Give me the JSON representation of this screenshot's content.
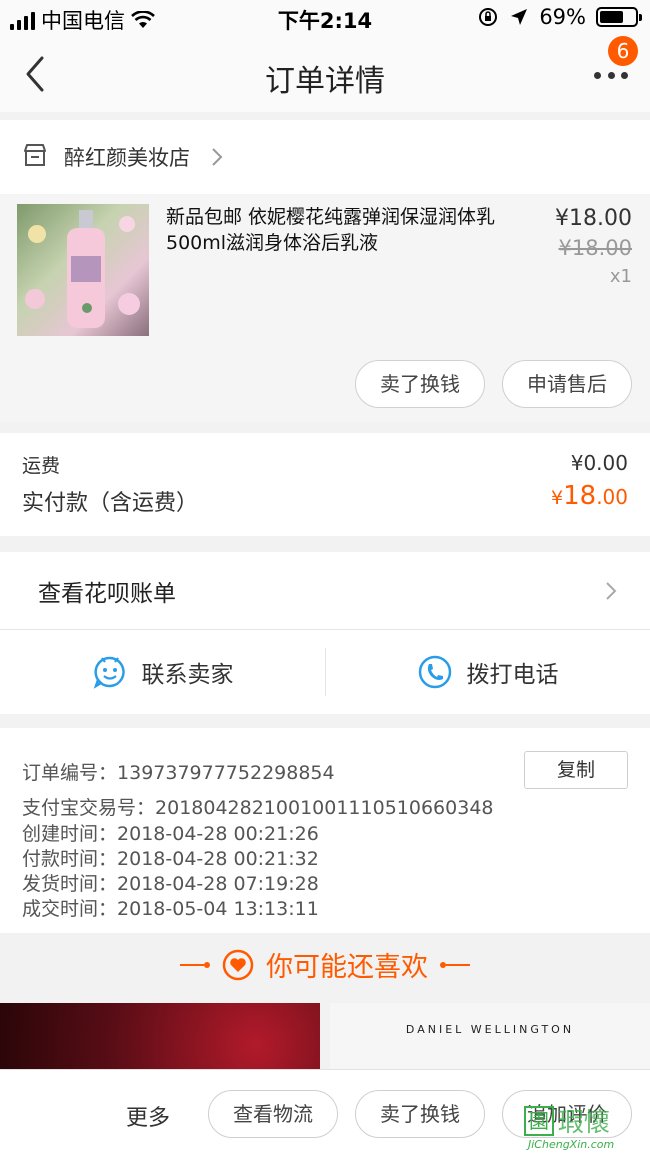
{
  "status_bar": {
    "carrier": "中国电信",
    "time": "下午2:14",
    "battery": "69%",
    "battery_level": 0.69
  },
  "nav": {
    "title": "订单详情",
    "badge": "6"
  },
  "shop": {
    "name": "醉红颜美妆店"
  },
  "product": {
    "title": "新品包邮 依妮樱花纯露弹润保湿润体乳500ml滋润身体浴后乳液",
    "price": "¥18.00",
    "original_price": "¥18.00",
    "quantity": "x1",
    "actions": [
      "卖了换钱",
      "申请售后"
    ]
  },
  "fees": {
    "shipping_label": "运费",
    "shipping_value": "¥0.00",
    "paid_label": "实付款（含运费）",
    "paid_currency": "¥",
    "paid_integer": "18",
    "paid_decimal": ".00"
  },
  "huabei": {
    "label": "查看花呗账单"
  },
  "contact": {
    "seller": "联系卖家",
    "phone": "拨打电话"
  },
  "order_info": {
    "order_no_label": "订单编号：",
    "order_no": "139737977752298854",
    "copy": "复制",
    "alipay_label": "支付宝交易号：",
    "alipay_no": "2018042821001001110510660348",
    "created_label": "创建时间：",
    "created": "2018-04-28 00:21:26",
    "paid_label": "付款时间：",
    "paid": "2018-04-28 00:21:32",
    "shipped_label": "发货时间：",
    "shipped": "2018-04-28 07:19:28",
    "done_label": "成交时间：",
    "done": "2018-05-04 13:13:11"
  },
  "recommend": {
    "title": "你可能还喜欢",
    "brand_tile": "DANIEL WELLINGTON"
  },
  "bottom_bar": {
    "more": "更多",
    "buttons": [
      "查看物流",
      "卖了换钱",
      "追加评价"
    ]
  },
  "watermark": {
    "text": "JiChengXin.com"
  },
  "colors": {
    "accent": "#ff5a00",
    "contact_icon": "#2a9de8"
  }
}
